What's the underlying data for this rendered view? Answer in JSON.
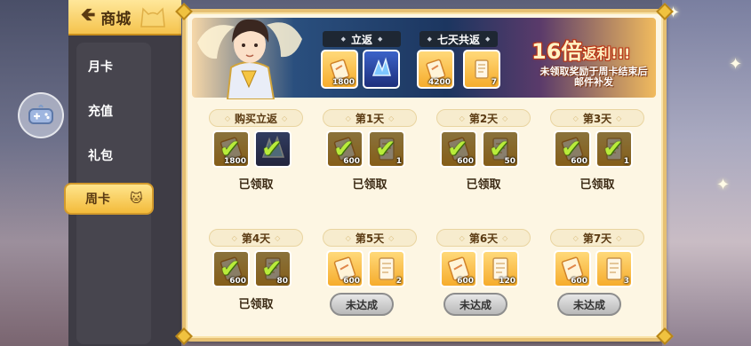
{
  "sidebar": {
    "header_title": "商城",
    "items": [
      {
        "label": "月卡",
        "active": false
      },
      {
        "label": "充值",
        "active": false
      },
      {
        "label": "礼包",
        "active": false
      },
      {
        "label": "周卡",
        "active": true
      }
    ]
  },
  "banner": {
    "instant_label": "立返",
    "seven_days_label": "七天共返",
    "instant_rewards": [
      {
        "icon": "scroll-voucher-icon",
        "count": "1800"
      },
      {
        "icon": "blue-crystal-icon",
        "count": ""
      }
    ],
    "seven_day_rewards": [
      {
        "icon": "scroll-voucher-icon",
        "count": "4200"
      },
      {
        "icon": "parchment-scroll-icon",
        "count": "7"
      }
    ],
    "multiplier": "16倍",
    "multiplier_suffix": "返利!!!",
    "note": "未领取奖励于周卡结束后邮件补发"
  },
  "days": [
    {
      "label": "购买立返",
      "rewards": [
        {
          "type": "gold",
          "count": "1800",
          "claimed": true
        },
        {
          "type": "blue",
          "count": "",
          "claimed": true
        }
      ],
      "status": "已领取",
      "claimed": true
    },
    {
      "label": "第1天",
      "rewards": [
        {
          "type": "gold",
          "count": "600",
          "claimed": true
        },
        {
          "type": "gold",
          "count": "1",
          "claimed": true
        }
      ],
      "status": "已领取",
      "claimed": true
    },
    {
      "label": "第2天",
      "rewards": [
        {
          "type": "gold",
          "count": "600",
          "claimed": true
        },
        {
          "type": "gold",
          "count": "50",
          "claimed": true
        }
      ],
      "status": "已领取",
      "claimed": true
    },
    {
      "label": "第3天",
      "rewards": [
        {
          "type": "gold",
          "count": "600",
          "claimed": true
        },
        {
          "type": "gold",
          "count": "1",
          "claimed": true
        }
      ],
      "status": "已领取",
      "claimed": true
    },
    {
      "label": "第4天",
      "rewards": [
        {
          "type": "gold",
          "count": "600",
          "claimed": true
        },
        {
          "type": "gold",
          "count": "80",
          "claimed": true
        }
      ],
      "status": "已领取",
      "claimed": true
    },
    {
      "label": "第5天",
      "rewards": [
        {
          "type": "gold",
          "count": "600",
          "claimed": false
        },
        {
          "type": "gold",
          "count": "2",
          "claimed": false
        }
      ],
      "status": "未达成",
      "claimed": false
    },
    {
      "label": "第6天",
      "rewards": [
        {
          "type": "gold",
          "count": "600",
          "claimed": false
        },
        {
          "type": "gold",
          "count": "120",
          "claimed": false
        }
      ],
      "status": "未达成",
      "claimed": false
    },
    {
      "label": "第7天",
      "rewards": [
        {
          "type": "gold",
          "count": "600",
          "claimed": false
        },
        {
          "type": "gold",
          "count": "3",
          "claimed": false
        }
      ],
      "status": "未达成",
      "claimed": false
    }
  ],
  "colors": {
    "accent_gold": "#f3bb3b",
    "claimed_check": "#b8ec3a",
    "panel_cream": "#fdf6e3",
    "sidebar_dark": "#3e3c45"
  }
}
